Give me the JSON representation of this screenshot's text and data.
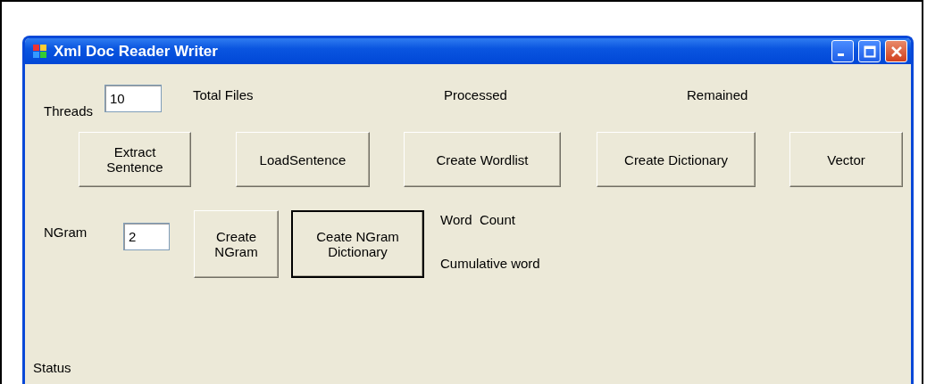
{
  "window": {
    "title": "Xml Doc Reader Writer"
  },
  "threads": {
    "label": "Threads",
    "value": "10"
  },
  "counters": [
    "Total Files",
    "Processed",
    "Remained"
  ],
  "actions": [
    {
      "label": "Extract\nSentence",
      "default": false
    },
    {
      "label": "LoadSentence",
      "default": false
    },
    {
      "label": "Create Wordlist",
      "default": false
    },
    {
      "label": "Create Dictionary",
      "default": false
    },
    {
      "label": "Vector",
      "default": false
    }
  ],
  "ngram": {
    "label": "NGram",
    "value": "2"
  },
  "ngram_actions": [
    {
      "label": "Create\nNGram",
      "default": false
    },
    {
      "label": "Ceate NGram\nDictionary",
      "default": true
    }
  ],
  "word_stats": [
    "Word  Count",
    "Cumulative word"
  ],
  "status": "Status"
}
